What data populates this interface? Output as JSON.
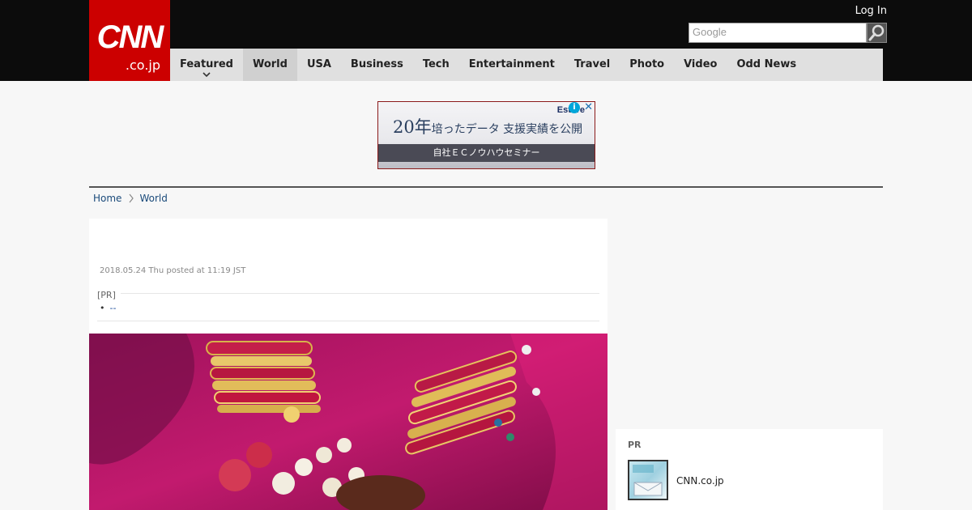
{
  "header": {
    "logo_main": "CNN",
    "logo_sub": ".co.jp",
    "login_label": "Log In",
    "search_placeholder": "Google"
  },
  "nav": {
    "items": [
      {
        "label": "Featured",
        "has_dropdown": true
      },
      {
        "label": "World",
        "active": true
      },
      {
        "label": "USA"
      },
      {
        "label": "Business"
      },
      {
        "label": "Tech"
      },
      {
        "label": "Entertainment"
      },
      {
        "label": "Travel"
      },
      {
        "label": "Photo"
      },
      {
        "label": "Video"
      },
      {
        "label": "Odd News"
      }
    ]
  },
  "ad": {
    "headline_big": "20年",
    "headline_rest": "培ったデータ 支援実績を公開",
    "strip": "自社ＥＣノウハウセミナー",
    "brand": "Estore"
  },
  "breadcrumb": {
    "home": "Home",
    "current": "World"
  },
  "article": {
    "date": "2018.05.24 Thu posted at 11:19 JST",
    "pr_label": "[PR]",
    "pr_link": "--"
  },
  "sidebar": {
    "pr_label": "PR",
    "item_label": "CNN.co.jp"
  },
  "colors": {
    "brand_red": "#cc0000",
    "topbar": "#0c0c0c",
    "nav_bg": "#e0e0e0",
    "link": "#1a4a7a"
  }
}
